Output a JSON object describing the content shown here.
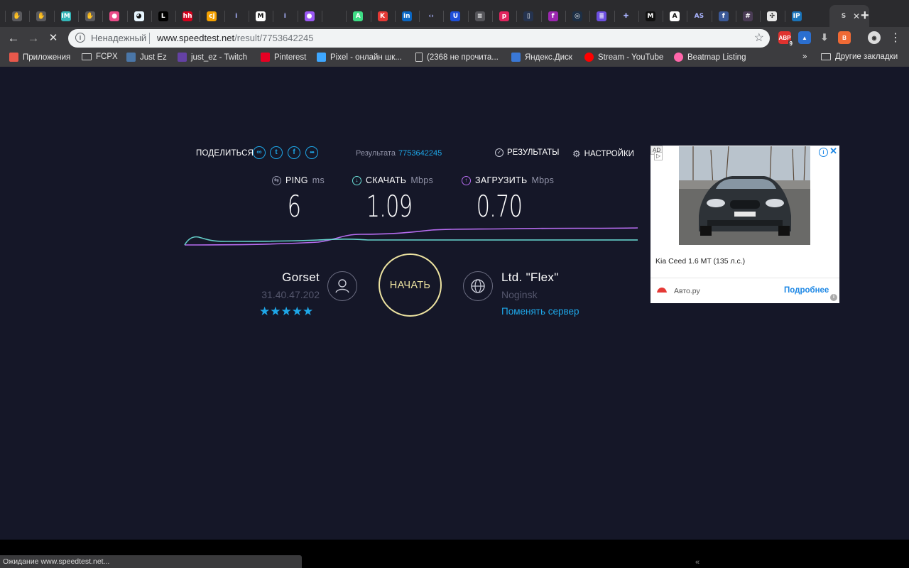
{
  "browser": {
    "tabs": [
      {
        "icon": "hand-icon",
        "color": "#5a5a5e",
        "glyph": "✋"
      },
      {
        "icon": "hand-icon",
        "color": "#5a5a5e",
        "glyph": "✋"
      },
      {
        "icon": "im-icon",
        "color": "#35b6b8",
        "glyph": "IM"
      },
      {
        "icon": "hand-icon",
        "color": "#5a5a5e",
        "glyph": "✋"
      },
      {
        "icon": "dribbble-icon",
        "color": "#ea4c89",
        "glyph": "●"
      },
      {
        "icon": "bot-icon",
        "color": "#e8f6ff",
        "glyph": "◕"
      },
      {
        "icon": "l-icon",
        "color": "#000000",
        "glyph": "L"
      },
      {
        "icon": "hh-icon",
        "color": "#d6001c",
        "glyph": "hh"
      },
      {
        "icon": "cj-icon",
        "color": "#f3a000",
        "glyph": "cj"
      },
      {
        "icon": "info-icon",
        "color": "#2b2b2e",
        "glyph": "i"
      },
      {
        "icon": "medium-icon",
        "color": "#ffffff",
        "glyph": "M"
      },
      {
        "icon": "info-icon",
        "color": "#2b2b2e",
        "glyph": "i"
      },
      {
        "icon": "circle-icon",
        "color": "#9b59f5",
        "glyph": "●"
      },
      {
        "icon": "apple-icon",
        "color": "#2b2b2e",
        "glyph": ""
      },
      {
        "icon": "android-icon",
        "color": "#3ddc84",
        "glyph": "A"
      },
      {
        "icon": "k-icon",
        "color": "#e53935",
        "glyph": "K"
      },
      {
        "icon": "linkedin-icon",
        "color": "#0a66c2",
        "glyph": "in"
      },
      {
        "icon": "code-icon",
        "color": "#2b2b2e",
        "glyph": "‹›"
      },
      {
        "icon": "shield-icon",
        "color": "#1e4fd8",
        "glyph": "U"
      },
      {
        "icon": "grid-icon",
        "color": "#55555a",
        "glyph": "≡"
      },
      {
        "icon": "p-icon",
        "color": "#e0245e",
        "glyph": "p"
      },
      {
        "icon": "frame-icon",
        "color": "#25334f",
        "glyph": "▯"
      },
      {
        "icon": "f-icon",
        "color": "#9c27b0",
        "glyph": "f"
      },
      {
        "icon": "globe-icon",
        "color": "#1d2f45",
        "glyph": "◎"
      },
      {
        "icon": "list-icon",
        "color": "#6c4fe0",
        "glyph": "≣"
      },
      {
        "icon": "plus-icon",
        "color": "#2b2b2e",
        "glyph": "✚"
      },
      {
        "icon": "medium-icon",
        "color": "#111111",
        "glyph": "M"
      },
      {
        "icon": "adobe-icon",
        "color": "#ffffff",
        "glyph": "A"
      },
      {
        "icon": "as-icon",
        "color": "#2b2b2e",
        "glyph": "AS"
      },
      {
        "icon": "facebook-icon",
        "color": "#3b5998",
        "glyph": "f"
      },
      {
        "icon": "hash-icon",
        "color": "#4a3c55",
        "glyph": "#"
      },
      {
        "icon": "slack-icon",
        "color": "#e8e8e8",
        "glyph": "✣"
      },
      {
        "icon": "ip-icon",
        "color": "#1a73b8",
        "glyph": "IP"
      }
    ],
    "active_tab_glyph": "S",
    "active_tab_close": "✕",
    "new_tab": "+",
    "address": {
      "security_label": "Ненадежный",
      "host": "www.speedtest.net",
      "path": "/result/7753642245"
    },
    "extensions": [
      {
        "icon": "abp-icon",
        "color": "#e0322f",
        "glyph": "ABP",
        "badge": "9"
      },
      {
        "icon": "triangle-icon",
        "color": "#2b6fd0",
        "glyph": "▲",
        "badge": ""
      },
      {
        "icon": "download-icon",
        "color": "#3c3c3f",
        "glyph": "⬇",
        "badge": ""
      },
      {
        "icon": "b-icon",
        "color": "#f06a35",
        "glyph": "B",
        "badge": ""
      },
      {
        "icon": "avatar-icon",
        "color": "#dcdcdc",
        "glyph": "◉",
        "badge": ""
      }
    ],
    "bookmarks": [
      {
        "icon": "apps-icon",
        "label": "Приложения",
        "color": "#e8584b"
      },
      {
        "icon": "folder-icon",
        "label": "FCPX",
        "color": ""
      },
      {
        "icon": "vk-icon",
        "label": "Just Ez",
        "color": "#4a76a8"
      },
      {
        "icon": "twitch-icon",
        "label": "just_ez - Twitch",
        "color": "#6441a4"
      },
      {
        "icon": "pinterest-icon",
        "label": "Pinterest",
        "color": "#e60023"
      },
      {
        "icon": "diamond-icon",
        "label": "Pixel - онлайн шк...",
        "color": "#3ea7ff"
      },
      {
        "icon": "page-icon",
        "label": "(2368 не прочита...",
        "color": ""
      },
      {
        "icon": "disk-icon",
        "label": "Яндекс.Диск",
        "color": "#3a78d6"
      },
      {
        "icon": "youtube-icon",
        "label": "Stream - YouTube",
        "color": "#ff0000"
      },
      {
        "icon": "osu-icon",
        "label": "Beatmap Listing",
        "color": "#ff66aa"
      }
    ],
    "bookmarks_more": "»",
    "other_bookmarks": "Другие закладки"
  },
  "speedtest": {
    "share_label": "ПОДЕЛИТЬСЯ",
    "result_label": "Результата",
    "result_id": "7753642245",
    "results_nav": "РЕЗУЛЬТАТЫ",
    "settings_nav": "НАСТРОЙКИ",
    "ping": {
      "label": "PING",
      "unit": "ms",
      "value": "6"
    },
    "download": {
      "label": "СКАЧАТЬ",
      "unit": "Mbps",
      "value": "1.09"
    },
    "upload": {
      "label": "ЗАГРУЗИТЬ",
      "unit": "Mbps",
      "value": "0.70"
    },
    "colors": {
      "accent": "#1ea7e8",
      "download": "#6be0d8",
      "upload": "#b66cf0",
      "start": "#ece2a0",
      "background": "#151728"
    },
    "isp": {
      "name": "Gorset",
      "ip": "31.40.47.202",
      "stars": "★★★★★",
      "rating": 5
    },
    "start_label": "НАЧАТЬ",
    "server": {
      "name": "Ltd. \"Flex\"",
      "location": "Noginsk",
      "change_label": "Поменять сервер"
    }
  },
  "ad": {
    "badge": "AD",
    "title": "Kia Ceed 1.6 MT (135 л.с.)",
    "source": "Авто.ру",
    "more": "Подробнее",
    "plate": "auto.ru"
  },
  "status_bar": "Ожидание www.speedtest.net...",
  "bottom_mark": "«"
}
